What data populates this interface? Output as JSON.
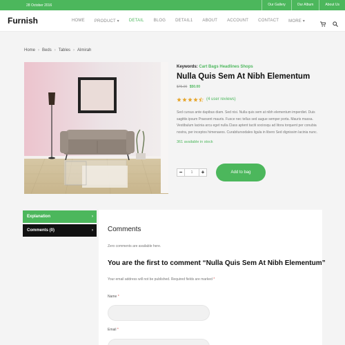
{
  "topbar": {
    "date": "28 October 2016",
    "links": [
      "Our Gallery",
      "Our Album",
      "About Us"
    ]
  },
  "header": {
    "logo": "Furnish",
    "nav": [
      "HOME",
      "PRODUCT ▾",
      "DETAIL",
      "BLOG",
      "DETAIL1",
      "ABOUT",
      "ACCOUNT",
      "CONTACT",
      "MORE ▾"
    ],
    "active_nav": "DETAIL",
    "icons": [
      "cart-icon",
      "search-icon"
    ]
  },
  "breadcrumb": [
    "Home",
    "Beds",
    "Tables",
    "Almirah"
  ],
  "product": {
    "keywords_label": "Keywords:",
    "keywords": "Cart Bags Headlines Shops",
    "title": "Nulla Quis Sem At Nibh Elementum",
    "old_price": "$75.00",
    "new_price": "$50.00",
    "rating": 4.5,
    "reviews": "(4 user reviews)",
    "description": "Sed cursus ante dapibus diam. Sed nisi. Nulla quis sem at nibh elementum imperdiet. Duis sagittis ipsum Praesent mauris. Fusce nec tellus sed augue semper porta. Mauris massa. Vestibulum lacinia arcu eget nulla.Class aptent taciti sociosqu ad litora torquent per conubia nostra, per inceptos himenaeos. Curabitursodales ligula in libero Sed dignissim lacinia nunc.",
    "stock": "361 available in stock",
    "quantity": "1",
    "add_button": "Add to bag",
    "accent": "#4cb75c"
  },
  "tabs": {
    "explanation": "Explanation",
    "comments": "Comments (0)"
  },
  "comments": {
    "heading": "Comments",
    "zero": "Zero comments are available here.",
    "first": "You are the first to comment “Nulla Quis Sem At Nibh Elementum”",
    "note": "Your email address will not be published. Required fields are marked",
    "name_label": "Name",
    "email_label": "Email"
  }
}
